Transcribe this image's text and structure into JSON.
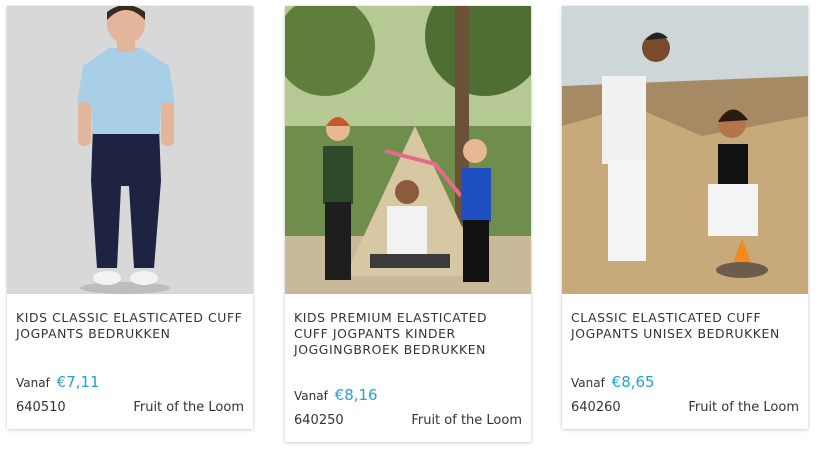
{
  "products": [
    {
      "image_alt": "child in light blue t-shirt and navy jogpants",
      "title": "KIDS CLASSIC ELASTICATED CUFF JOGPANTS BEDRUKKEN",
      "price_prefix": "Vanaf",
      "price": "€7,11",
      "sku": "640510",
      "brand": "Fruit of the Loom"
    },
    {
      "image_alt": "family playing outdoors near a teepee",
      "title": "KIDS PREMIUM ELASTICATED CUFF JOGPANTS KINDER JOGGINGBROEK BEDRUKKEN",
      "price_prefix": "Vanaf",
      "price": "€8,16",
      "sku": "640250",
      "brand": "Fruit of the Loom"
    },
    {
      "image_alt": "couple sitting on rocks by the sea",
      "title": "CLASSIC ELASTICATED CUFF JOGPANTS UNISEX BEDRUKKEN",
      "price_prefix": "Vanaf",
      "price": "€8,65",
      "sku": "640260",
      "brand": "Fruit of the Loom"
    }
  ],
  "colors": {
    "price": "#22a2cf",
    "text": "#333333"
  }
}
